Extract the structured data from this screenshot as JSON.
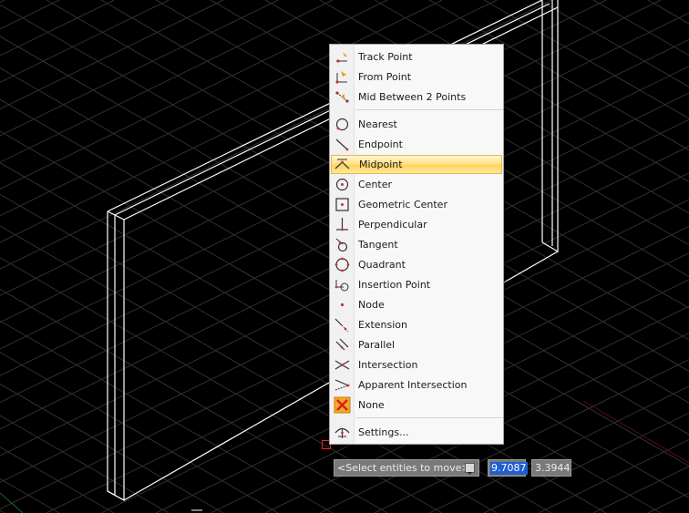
{
  "menu": {
    "items": [
      {
        "label": "Track Point",
        "icon": "track-point-icon"
      },
      {
        "label": "From Point",
        "icon": "from-point-icon"
      },
      {
        "label": "Mid Between 2 Points",
        "icon": "mid-between-icon"
      },
      {
        "label": "Nearest",
        "icon": "nearest-icon"
      },
      {
        "label": "Endpoint",
        "icon": "endpoint-icon"
      },
      {
        "label": "Midpoint",
        "icon": "midpoint-icon"
      },
      {
        "label": "Center",
        "icon": "center-icon"
      },
      {
        "label": "Geometric Center",
        "icon": "geometric-center-icon"
      },
      {
        "label": "Perpendicular",
        "icon": "perpendicular-icon"
      },
      {
        "label": "Tangent",
        "icon": "tangent-icon"
      },
      {
        "label": "Quadrant",
        "icon": "quadrant-icon"
      },
      {
        "label": "Insertion Point",
        "icon": "insertion-point-icon"
      },
      {
        "label": "Node",
        "icon": "node-icon"
      },
      {
        "label": "Extension",
        "icon": "extension-icon"
      },
      {
        "label": "Parallel",
        "icon": "parallel-icon"
      },
      {
        "label": "Intersection",
        "icon": "intersection-icon"
      },
      {
        "label": "Apparent Intersection",
        "icon": "apparent-intersection-icon"
      },
      {
        "label": "None",
        "icon": "none-icon"
      },
      {
        "label": "Settings...",
        "icon": "settings-icon"
      }
    ],
    "highlighted": "Midpoint"
  },
  "command_prompt": {
    "text": "<Select entities to move>"
  },
  "coordinates": {
    "x_value": "9.7087",
    "y_value": "3.3944"
  },
  "colors": {
    "background": "#000000",
    "grid": "#3a3a3a",
    "geometry": "#ffffff",
    "snap_marker": "#ff2020",
    "selection_blue": "#1f5fcf"
  }
}
